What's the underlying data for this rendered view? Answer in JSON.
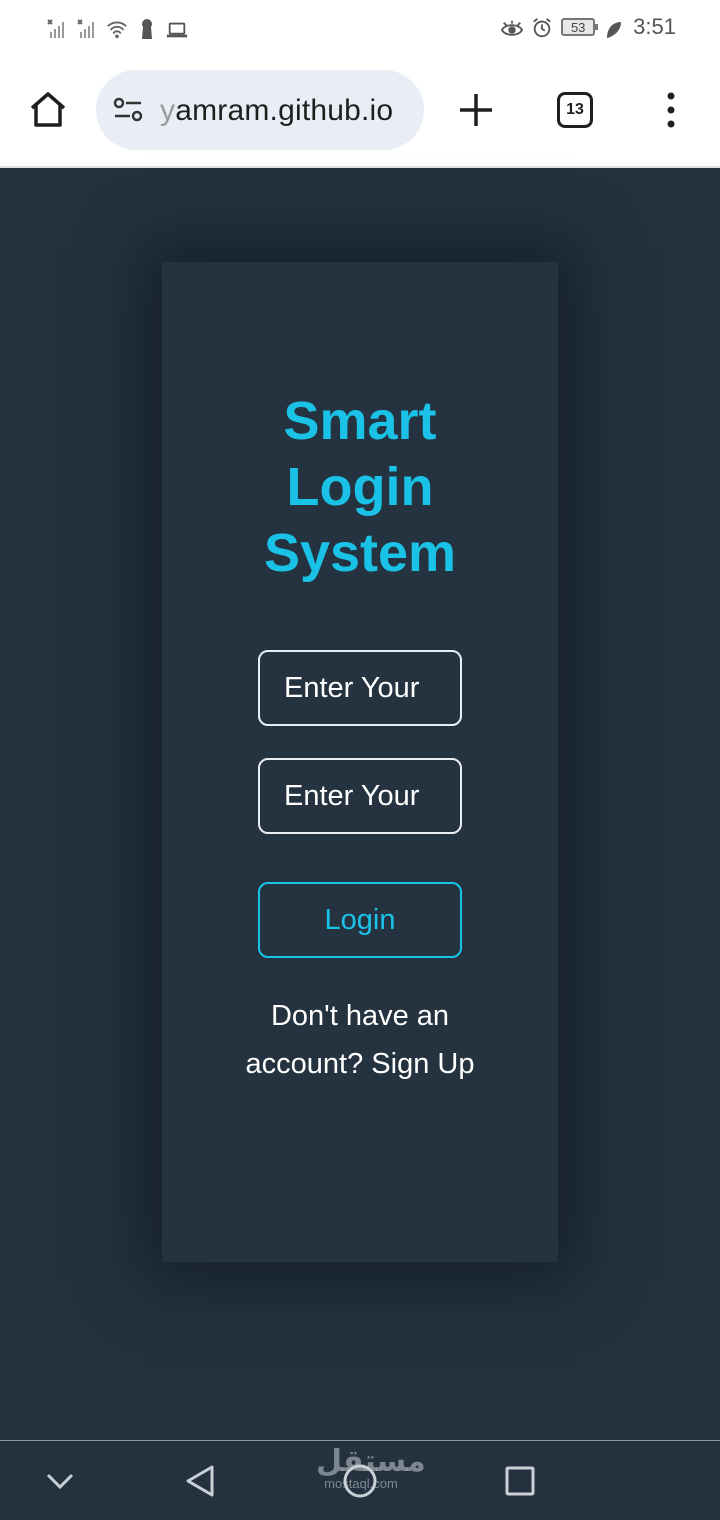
{
  "status_bar": {
    "time": "3:51",
    "battery": "53",
    "icons": [
      "signal-off-icon",
      "signal-off-icon",
      "wifi-icon",
      "keyhole-icon",
      "laptop-icon",
      "eye-icon",
      "alarm-icon",
      "battery-icon",
      "leaf-icon"
    ]
  },
  "browser": {
    "url_prefix": "y",
    "url_rest": "amram.github.io",
    "tab_count": "13",
    "icons": [
      "home-icon",
      "tune-icon",
      "plus-icon",
      "tabs-icon",
      "more-vert-icon"
    ]
  },
  "login_card": {
    "title_line1": "Smart",
    "title_line2": "Login",
    "title_line3": "System",
    "email_placeholder": "Enter Your",
    "password_placeholder": "Enter Your",
    "login_label": "Login",
    "signup_text": "Don't have an account? Sign Up"
  },
  "nav_bar": {
    "watermark_logo": "مستقل",
    "watermark_sub": "mostaql.com",
    "icons": [
      "chevron-down-icon",
      "back-triangle-icon",
      "home-circle-icon",
      "recent-square-icon"
    ]
  },
  "colors": {
    "accent": "#19c2e6",
    "page_background": "#24323f",
    "card_background": "#24333f",
    "text_light": "#ffffff"
  }
}
